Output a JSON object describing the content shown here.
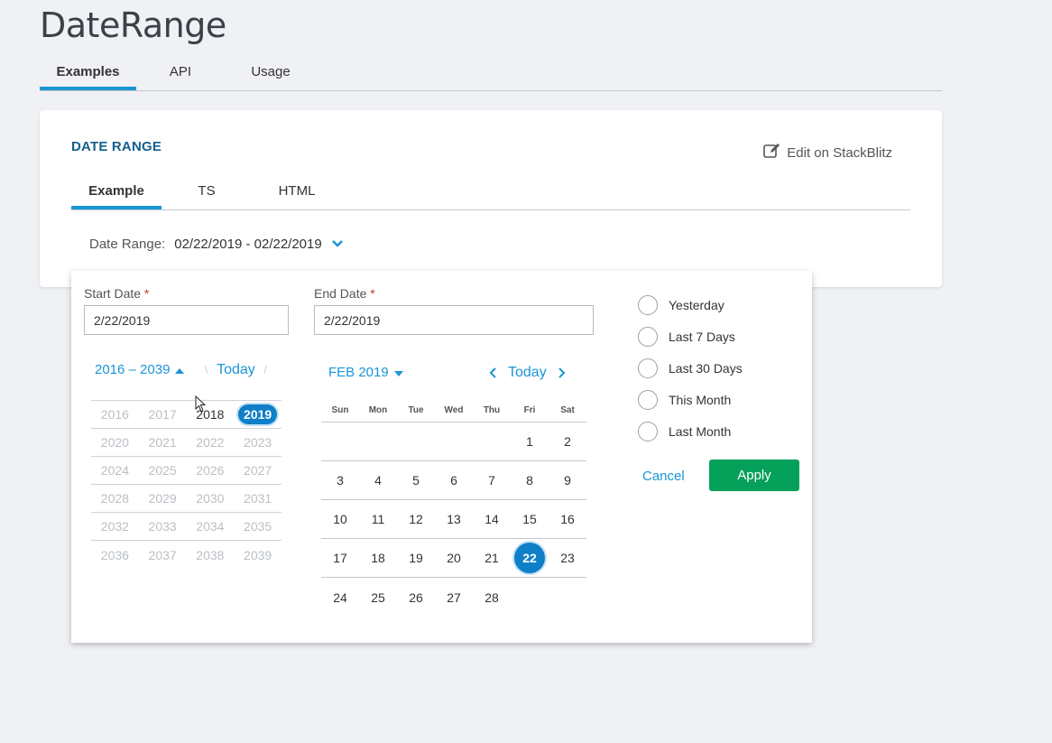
{
  "page": {
    "title": "DateRange"
  },
  "top_tabs": [
    {
      "label": "Examples",
      "active": true
    },
    {
      "label": "API",
      "active": false
    },
    {
      "label": "Usage",
      "active": false
    }
  ],
  "card": {
    "title": "DATE RANGE",
    "edit_link": "Edit on StackBlitz",
    "tabs": [
      {
        "label": "Example",
        "active": true
      },
      {
        "label": "TS",
        "active": false
      },
      {
        "label": "HTML",
        "active": false
      }
    ],
    "date_range_label": "Date Range:",
    "date_range_value": "02/22/2019 - 02/22/2019"
  },
  "popup": {
    "start_label": "Start Date",
    "end_label": "End Date",
    "required_mark": "*",
    "start_value": "2/22/2019",
    "end_value": "2/22/2019",
    "year_picker": {
      "range_label": "2016 – 2039",
      "today_label": "Today",
      "prev_glyph": "\\",
      "next_glyph": "/",
      "rows": [
        [
          "2016",
          "2017",
          "2018",
          "2019"
        ],
        [
          "2020",
          "2021",
          "2022",
          "2023"
        ],
        [
          "2024",
          "2025",
          "2026",
          "2027"
        ],
        [
          "2028",
          "2029",
          "2030",
          "2031"
        ],
        [
          "2032",
          "2033",
          "2034",
          "2035"
        ],
        [
          "2036",
          "2037",
          "2038",
          "2039"
        ]
      ],
      "current_year": "2018",
      "selected_year": "2019"
    },
    "calendar": {
      "month_label": "FEB 2019",
      "today_label": "Today",
      "weekdays": [
        "Sun",
        "Mon",
        "Tue",
        "Wed",
        "Thu",
        "Fri",
        "Sat"
      ],
      "weeks": [
        [
          "",
          "",
          "",
          "",
          "",
          "1",
          "2"
        ],
        [
          "3",
          "4",
          "5",
          "6",
          "7",
          "8",
          "9"
        ],
        [
          "10",
          "11",
          "12",
          "13",
          "14",
          "15",
          "16"
        ],
        [
          "17",
          "18",
          "19",
          "20",
          "21",
          "22",
          "23"
        ],
        [
          "24",
          "25",
          "26",
          "27",
          "28",
          "",
          ""
        ]
      ],
      "selected_day": "22"
    },
    "presets": [
      "Yesterday",
      "Last 7 Days",
      "Last 30 Days",
      "This Month",
      "Last Month"
    ],
    "cancel_label": "Cancel",
    "apply_label": "Apply"
  },
  "colors": {
    "accent": "#1a96d4",
    "selected": "#0f7fc7",
    "apply": "#05a05a",
    "title": "#15608f"
  }
}
